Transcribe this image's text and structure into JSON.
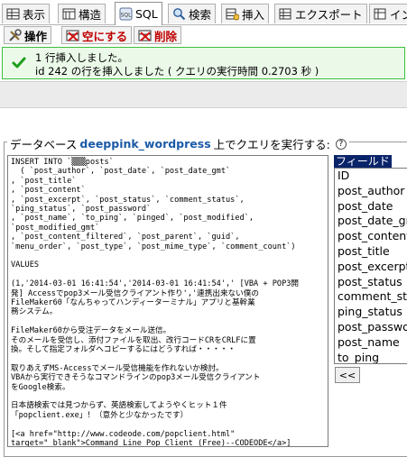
{
  "tabs": [
    {
      "label": "表示",
      "icon": "table-icon"
    },
    {
      "label": "構造",
      "icon": "structure-icon"
    },
    {
      "label": "SQL",
      "icon": "sql-icon"
    },
    {
      "label": "検索",
      "icon": "search-icon"
    },
    {
      "label": "挿入",
      "icon": "insert-icon"
    },
    {
      "label": "エクスポート",
      "icon": "export-icon"
    },
    {
      "label": "イン",
      "icon": "import-icon"
    }
  ],
  "active_tab": "SQL",
  "subtabs": [
    {
      "label": "操作",
      "icon": "operations-icon"
    },
    {
      "label": "空にする",
      "icon": "empty-icon"
    },
    {
      "label": "削除",
      "icon": "drop-icon"
    }
  ],
  "message": {
    "line1": "1 行挿入しました。",
    "line2": "id 242 の行を挿入しました ( クエリの実行時間 0.2703 秒 )"
  },
  "query_panel": {
    "prefix": "データベース",
    "database": "deeppink_wordpress",
    "suffix": "上でクエリを実行する:"
  },
  "sql_lines": [
    "INSERT INTO `▒▒▒posts`",
    "  ( `post_author`, `post_date`, `post_date_gmt`",
    ", `post_title`",
    ", `post_content`",
    ", `post_excerpt`, `post_status`, `comment_status`,",
    "`ping_status`, `post_password`",
    ", `post_name`, `to_ping`, `pinged`, `post_modified`,",
    "`post_modified_gmt`",
    ", `post_content_filtered`, `post_parent`, `guid`,",
    "`menu_order`, `post_type`, `post_mime_type`, `comment_count`)",
    "",
    "VALUES",
    "",
    "(1,'2014-03-01 16:41:54','2014-03-01 16:41:54',' [VBA + POP3開",
    "発] Accessでpop3メール受信クライアント作り','連携出来ない僕の",
    "FileMaker60「なんちゃってハンディーターミナル」アプリと基幹業",
    "務システム。",
    "",
    "FileMaker60から受注データをメール送信。",
    "そのメールを受信し、添付ファイルを取出、改行コードCRをCRLFに置",
    "換。そして指定フォルダへコピーするにはどうすれば・・・・・",
    "",
    "取りあえずMS-Accessでメール受信機能を作れないか検討。",
    "VBAから実行できそうなコマンドラインのpop3メール受信クライアント",
    "をGoogle検索。",
    "",
    "日本語検索では見つからず、英語検索してようやくヒット１件",
    "「popclient.exe」！（意外と少なかったです）",
    "",
    "[<a href=\"http://www.codeode.com/popclient.html\"",
    "target=\"_blank\">Command Line Pop Client (Free)--CODEODE</a>]"
  ],
  "fields_label": "フィールド",
  "fields": [
    "ID",
    "post_author",
    "post_date",
    "post_date_gmt",
    "post_content",
    "post_title",
    "post_excerpt",
    "post_status",
    "comment_status",
    "ping_status",
    "post_password",
    "post_name",
    "to_ping"
  ],
  "insert_button": "<<"
}
